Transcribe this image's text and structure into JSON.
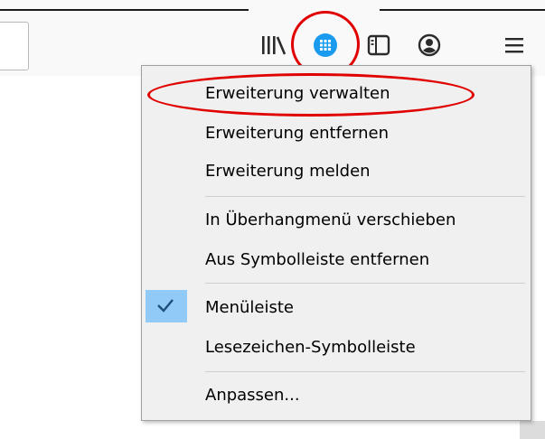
{
  "menu": {
    "items": [
      {
        "label": "Erweiterung verwalten"
      },
      {
        "label": "Erweiterung entfernen"
      },
      {
        "label": "Erweiterung melden"
      },
      {
        "label": "In Überhangmenü verschieben"
      },
      {
        "label": "Aus Symbolleiste entfernen"
      },
      {
        "label": "Menüleiste",
        "checked": true
      },
      {
        "label": "Lesezeichen-Symbolleiste"
      },
      {
        "label": "Anpassen..."
      }
    ]
  },
  "toolbar": {
    "icons": [
      "library-icon",
      "extension-globe-icon",
      "sidebar-icon",
      "account-icon",
      "hamburger-menu-icon"
    ]
  },
  "colors": {
    "annotation": "#e00000",
    "extension_icon": "#1a9bf0",
    "checked_bg": "#91c9f7"
  }
}
